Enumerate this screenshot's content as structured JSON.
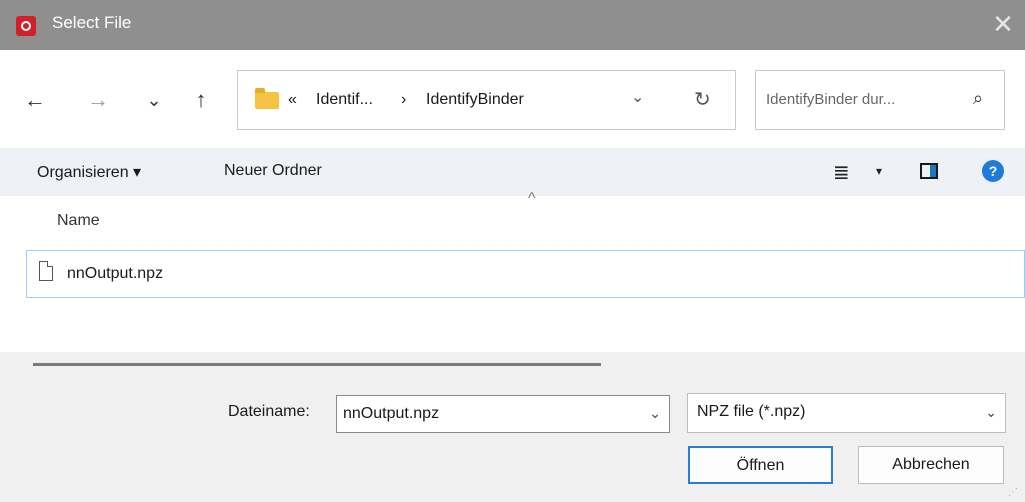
{
  "window": {
    "title": "Select File",
    "close_glyph": "✕"
  },
  "nav": {
    "back_glyph": "←",
    "forward_glyph": "→",
    "recent_glyph": "⌄",
    "up_glyph": "↑"
  },
  "address": {
    "overflow_glyph": "«",
    "crumbs": [
      "Identif...",
      "IdentifyBinder"
    ],
    "separator_glyph": "›",
    "dropdown_glyph": "⌄",
    "refresh_glyph": "↻"
  },
  "search": {
    "placeholder": "IdentifyBinder dur...",
    "icon_glyph": "⌕"
  },
  "toolbar": {
    "organize_label": "Organisieren ▾",
    "new_folder_label": "Neuer Ordner",
    "view_glyph": "≣",
    "view_dd_glyph": "▾",
    "help_glyph": "?"
  },
  "list": {
    "sort_glyph": "^",
    "column_name": "Name",
    "files": [
      {
        "name": "nnOutput.npz",
        "icon": "document-icon"
      }
    ]
  },
  "footer": {
    "filename_label": "Dateiname:",
    "filename_value": "nnOutput.npz",
    "filename_dd_glyph": "⌄",
    "filter_value": "NPZ file (*.npz)",
    "filter_dd_glyph": "⌄",
    "open_label": "Öffnen",
    "cancel_label": "Abbrechen",
    "grip_glyph": "⋰"
  },
  "colors": {
    "titlebar": "#8f8f8f",
    "toolbar": "#eef1f6",
    "accent": "#2a7fd3",
    "folder": "#f5c242",
    "app_icon": "#d0212a"
  }
}
